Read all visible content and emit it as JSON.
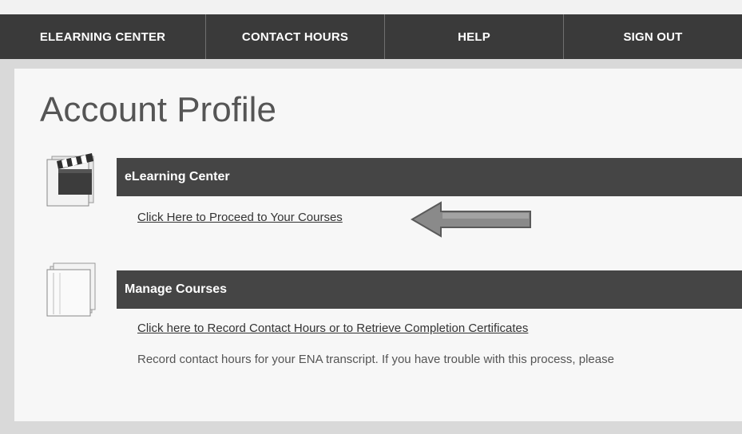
{
  "nav": {
    "items": [
      {
        "label": "ELEARNING CENTER"
      },
      {
        "label": "CONTACT HOURS"
      },
      {
        "label": "HELP"
      },
      {
        "label": "SIGN OUT"
      }
    ]
  },
  "page": {
    "title": "Account Profile"
  },
  "sections": [
    {
      "header": "eLearning Center",
      "link": "Click Here to Proceed to Your Courses",
      "icon": "clapperboard-icon"
    },
    {
      "header": "Manage Courses",
      "link": "Click here to Record Contact Hours or to Retrieve Completion Certificates",
      "description": "Record contact hours for your ENA transcript. If you have trouble with this process, please",
      "icon": "book-icon"
    }
  ],
  "colors": {
    "nav_bg": "#3a3a3a",
    "section_header_bg": "#454545",
    "page_bg": "#f7f7f7",
    "arrow_fill": "#8a8a8a"
  }
}
